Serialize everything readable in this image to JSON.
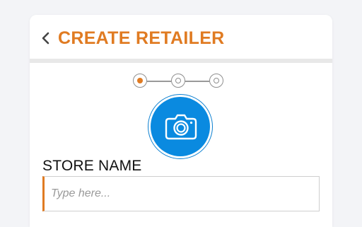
{
  "header": {
    "title": "CREATE RETAILER",
    "back_icon": "chevron-left-icon"
  },
  "stepper": {
    "current_step": 1,
    "total_steps": 3
  },
  "photo": {
    "icon": "camera-icon"
  },
  "form": {
    "store_name_label": "STORE NAME",
    "store_name_placeholder": "Type here...",
    "store_name_value": ""
  },
  "colors": {
    "accent": "#e07b22",
    "primary_blue": "#0a8ae0",
    "background": "#f3f4f7",
    "card": "#ffffff"
  }
}
